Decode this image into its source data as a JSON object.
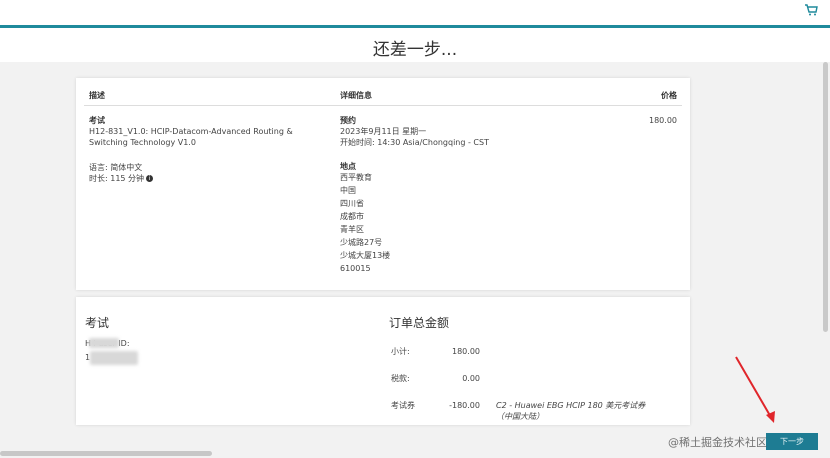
{
  "header": {
    "title": "还差一步..."
  },
  "icons": {
    "cart": "cart-icon",
    "info": "info-icon"
  },
  "order_card": {
    "headers": {
      "description": "描述",
      "details": "详细信息",
      "price": "价格"
    },
    "exam": {
      "label": "考试",
      "name_line1": "H12-831_V1.0: HCIP-Datacom-Advanced Routing &",
      "name_line2": "Switching Technology V1.0",
      "language": "语言: 简体中文",
      "duration": "时长: 115 分钟"
    },
    "booking": {
      "label": "预约",
      "date": "2023年9月11日 星期一",
      "start_time": "开始时间: 14:30 Asia/Chongqing - CST"
    },
    "location": {
      "label": "地点",
      "lines": [
        "西平教育",
        "中国",
        "四川省",
        "成都市",
        "青羊区",
        "少城路27号",
        "少城大厦13楼",
        "610015"
      ]
    },
    "price": "180.00"
  },
  "summary_card": {
    "exam_title": "考试",
    "user_id_label": "H      i user ID:",
    "user_id_value": "1",
    "order_total_title": "订单总金额",
    "rows": [
      {
        "label": "小计:",
        "value": "180.00",
        "note": ""
      },
      {
        "label": "税款:",
        "value": "0.00",
        "note": ""
      },
      {
        "label": "考试券",
        "value": "-180.00",
        "note": "C2 - Huawei EBG HCIP 180 美元考试券（中国大陆）"
      }
    ]
  },
  "next_button": {
    "label": "下一步"
  },
  "watermark": "@稀土掘金技术社区",
  "colors": {
    "accent": "#1f8a9c",
    "button": "#1e7c93",
    "arrow": "#e0262b"
  }
}
